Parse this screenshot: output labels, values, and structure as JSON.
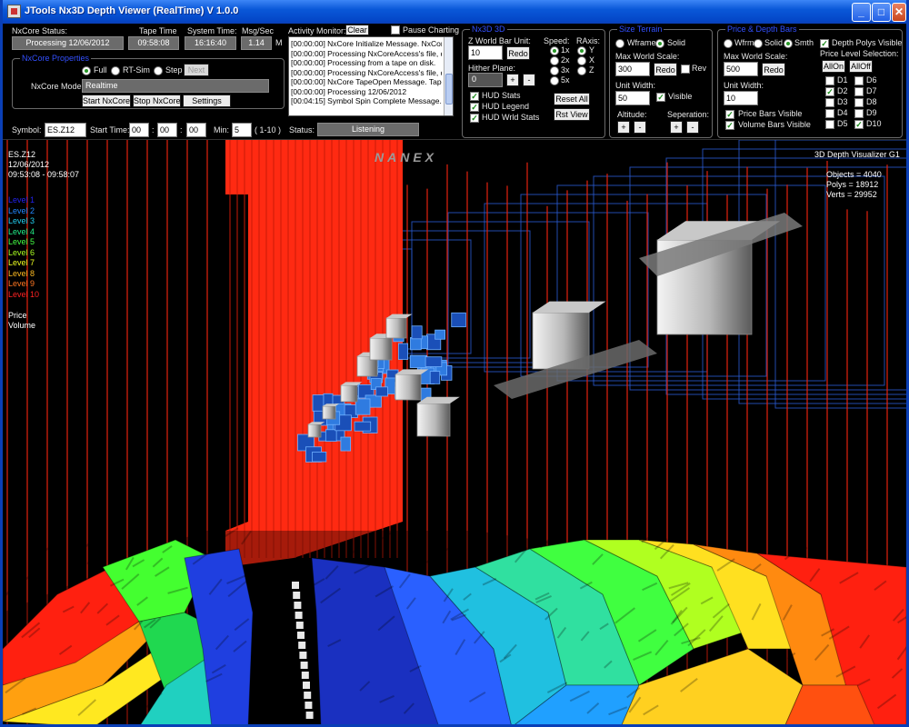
{
  "window": {
    "title": "JTools Nx3D Depth Viewer (RealTime) V 1.0.0",
    "min_icon": "minimize-icon",
    "max_icon": "maximize-icon",
    "close_icon": "close-icon"
  },
  "status_row": {
    "nxcore_status_label": "NxCore Status:",
    "nxcore_status_value": "Processing 12/06/2012",
    "tape_time_label": "Tape Time",
    "tape_time_value": "09:58:08",
    "system_time_label": "System Time:",
    "system_time_value": "16:16:40",
    "msg_sec_label": "Msg/Sec",
    "msg_sec_value": "1.14",
    "msg_sec_unit": "M"
  },
  "nxcore_properties": {
    "title": "NxCore Properties",
    "modes": [
      "Full",
      "RT-Sim",
      "Step"
    ],
    "selected_mode": "Full",
    "next_label": "Next",
    "mode_label": "NxCore Mode:",
    "mode_value": "Realtime",
    "start_label": "Start NxCore",
    "stop_label": "Stop NxCore",
    "settings_label": "Settings"
  },
  "activity": {
    "label": "Activity Monitor:",
    "clear_label": "Clear",
    "pause_label": "Pause Charting",
    "lines": [
      "[00:00:00] NxCore Initialize Message. NxCore",
      "[00:00:00] Processing NxCoreAccess's file, dl",
      "[00:00:00] Processing from a tape on disk.",
      "[00:00:00] Processing NxCoreAccess's file, dl",
      "[00:00:00] NxCore TapeOpen Message. Tape",
      "[00:00:00] Processing 12/06/2012",
      "[00:04:15] Symbol Spin Complete Message."
    ]
  },
  "symbol_row": {
    "symbol_label": "Symbol:",
    "symbol_value": "ES.Z12",
    "start_time_label": "Start Time:",
    "hh": "00",
    "mm": "00",
    "ss": "00",
    "sep": ":",
    "min_label": "Min:",
    "min_value": "5",
    "min_range": "( 1-10 )",
    "status_label": "Status:",
    "status_value": "Listening"
  },
  "nx3d": {
    "title": "Nx3D 3D",
    "z_world_label": "Z World Bar Unit:",
    "z_world_value": "10",
    "redo_label": "Redo",
    "hither_label": "Hither Plane:",
    "hither_value": "0",
    "plus": "+",
    "minus": "-",
    "speed_label": "Speed:",
    "speeds": [
      "1x",
      "2x",
      "3x",
      "5x"
    ],
    "selected_speed": "1x",
    "raxis_label": "RAxis:",
    "axes": [
      "Y",
      "X",
      "Z"
    ],
    "selected_axis": "Y",
    "hud_stats": "HUD Stats",
    "hud_legend": "HUD Legend",
    "hud_wrld_stats": "HUD Wrld Stats",
    "reset_all": "Reset All",
    "rst_view": "Rst View"
  },
  "size_terrain": {
    "title": "Size Terrain",
    "wframe": "Wframe",
    "solid": "Solid",
    "selected": "Solid",
    "max_scale_label": "Max World Scale:",
    "max_scale_value": "300",
    "redo_label": "Redo",
    "rev_label": "Rev",
    "unit_width_label": "Unit Width:",
    "unit_width_value": "50",
    "visible_label": "Visible",
    "altitude_label": "Altitude:",
    "separation_label": "Seperation:",
    "plus": "+",
    "minus": "-"
  },
  "price_depth": {
    "title": "Price & Depth Bars",
    "wfrm": "Wfrm",
    "solid": "Solid",
    "smth": "Smth",
    "selected": "Smth",
    "depth_polys_label": "Depth Polys Visible",
    "level_selection_label": "Price Level Selection:",
    "allon": "AllOn",
    "alloff": "AllOff",
    "max_scale_label": "Max World Scale:",
    "max_scale_value": "500",
    "redo_label": "Redo",
    "unit_width_label": "Unit Width:",
    "unit_width_value": "10",
    "price_bars_label": "Price Bars Visible",
    "volume_bars_label": "Volume Bars Visible",
    "levels": [
      {
        "name": "D1",
        "checked": false
      },
      {
        "name": "D2",
        "checked": true
      },
      {
        "name": "D3",
        "checked": false
      },
      {
        "name": "D4",
        "checked": false
      },
      {
        "name": "D5",
        "checked": false
      },
      {
        "name": "D6",
        "checked": false
      },
      {
        "name": "D7",
        "checked": false
      },
      {
        "name": "D8",
        "checked": false
      },
      {
        "name": "D9",
        "checked": false
      },
      {
        "name": "D10",
        "checked": true
      }
    ]
  },
  "viewport": {
    "symbol": "ES.Z12",
    "date": "12/06/2012",
    "time_range": "09:53:08 - 09:58:07",
    "brand": "NANEX",
    "visualizer_name": "3D Depth Visualizer G1",
    "objects": "Objects = 4040",
    "polys": "Polys = 18912",
    "verts": "Verts = 29952",
    "legend": [
      {
        "label": "Level 1",
        "color": "#2222ee"
      },
      {
        "label": "Level 2",
        "color": "#2288ff"
      },
      {
        "label": "Level 3",
        "color": "#22ccee"
      },
      {
        "label": "Level 4",
        "color": "#22ee88"
      },
      {
        "label": "Level 5",
        "color": "#44ff44"
      },
      {
        "label": "Level 6",
        "color": "#aaff22"
      },
      {
        "label": "Level 7",
        "color": "#eeff22"
      },
      {
        "label": "Level 8",
        "color": "#ffbb22"
      },
      {
        "label": "Level 9",
        "color": "#ff7722"
      },
      {
        "label": "Level 10",
        "color": "#ff2222"
      }
    ],
    "legend_price": "Price",
    "legend_volume": "Volume"
  }
}
